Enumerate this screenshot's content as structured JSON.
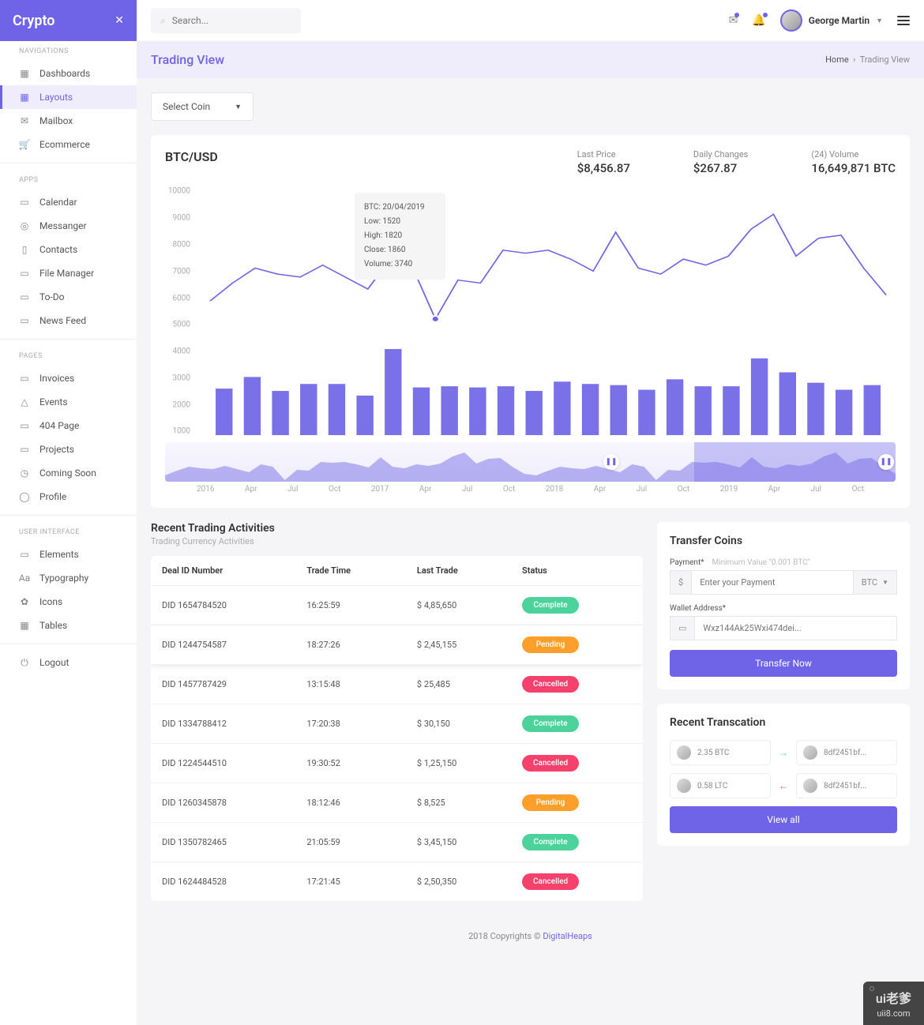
{
  "brand": "Crypto",
  "search_placeholder": "Search...",
  "user": {
    "name": "George Martin"
  },
  "nav": {
    "sections": [
      {
        "header": "NAVIGATIONS",
        "items": [
          {
            "label": "Dashboards",
            "icon": "▦"
          },
          {
            "label": "Layouts",
            "icon": "▦",
            "active": true
          },
          {
            "label": "Mailbox",
            "icon": "✉"
          },
          {
            "label": "Ecommerce",
            "icon": "🛒"
          }
        ]
      },
      {
        "header": "APPS",
        "items": [
          {
            "label": "Calendar",
            "icon": "▭"
          },
          {
            "label": "Messanger",
            "icon": "◎"
          },
          {
            "label": "Contacts",
            "icon": "▯"
          },
          {
            "label": "File Manager",
            "icon": "▭"
          },
          {
            "label": "To-Do",
            "icon": "▭"
          },
          {
            "label": "News Feed",
            "icon": "▭"
          }
        ]
      },
      {
        "header": "PAGES",
        "items": [
          {
            "label": "Invoices",
            "icon": "▭"
          },
          {
            "label": "Events",
            "icon": "△"
          },
          {
            "label": "404 Page",
            "icon": "▭"
          },
          {
            "label": "Projects",
            "icon": "▭"
          },
          {
            "label": "Coming Soon",
            "icon": "◷"
          },
          {
            "label": "Profile",
            "icon": "◯"
          }
        ]
      },
      {
        "header": "USER INTERFACE",
        "items": [
          {
            "label": "Elements",
            "icon": "▭"
          },
          {
            "label": "Typography",
            "icon": "Aa"
          },
          {
            "label": "Icons",
            "icon": "✿"
          },
          {
            "label": "Tables",
            "icon": "▦"
          }
        ]
      }
    ],
    "logout": "Logout"
  },
  "page": {
    "title": "Trading View",
    "breadcrumb_home": "Home",
    "breadcrumb_current": "Trading View"
  },
  "select_coin": "Select Coin",
  "chart": {
    "pair": "BTC/USD",
    "stats": {
      "last_price_label": "Last Price",
      "last_price": "$8,456.87",
      "daily_changes_label": "Daily Changes",
      "daily_changes": "$267.87",
      "volume_label": "(24) Volume",
      "volume": "16,649,871 BTC"
    },
    "tooltip": {
      "date": "BTC: 20/04/2019",
      "low": "Low: 1520",
      "high": "High: 1820",
      "close": "Close: 1860",
      "volume": "Volume: 3740"
    }
  },
  "chart_data": {
    "type": "combo",
    "y_ticks": [
      1000,
      2000,
      3000,
      4000,
      5000,
      6000,
      7000,
      8000,
      9000,
      10000
    ],
    "line_series": {
      "name": "Price",
      "ylim": [
        5500,
        10000
      ],
      "values": [
        6300,
        6900,
        7400,
        7200,
        7100,
        7500,
        7100,
        6700,
        7700,
        7400,
        5700,
        7000,
        6900,
        8000,
        7900,
        8000,
        7700,
        7300,
        8600,
        7400,
        7200,
        7700,
        7500,
        7800,
        8700,
        9200,
        7800,
        8400,
        8500,
        7400,
        6500
      ]
    },
    "bar_series": {
      "name": "Volume",
      "ylim": [
        0,
        4000
      ],
      "values": [
        2000,
        2500,
        1900,
        2200,
        2200,
        1700,
        3700,
        2050,
        2100,
        2050,
        2100,
        1900,
        2300,
        2200,
        2150,
        1950,
        2400,
        2100,
        2100,
        3300,
        2700,
        2250,
        1950,
        2150
      ]
    },
    "brush_x_ticks": [
      "2016",
      "Apr",
      "Jul",
      "Oct",
      "2017",
      "Apr",
      "Jul",
      "Oct",
      "2018",
      "Apr",
      "Jul",
      "Oct",
      "2019",
      "Apr",
      "Jul",
      "Oct"
    ]
  },
  "activities": {
    "title": "Recent Trading Activities",
    "subtitle": "Trading Currency Activities",
    "headers": {
      "deal": "Deal ID Number",
      "time": "Trade Time",
      "last": "Last Trade",
      "status": "Status"
    },
    "rows": [
      {
        "deal": "DID 1654784520",
        "time": "16:25:59",
        "last": "$ 4,85,650",
        "status": "Complete",
        "status_class": "complete"
      },
      {
        "deal": "DID 1244754587",
        "time": "18:27:26",
        "last": "$ 2,45,155",
        "status": "Pending",
        "status_class": "pending",
        "highlight": true
      },
      {
        "deal": "DID 1457787429",
        "time": "13:15:48",
        "last": "$ 25,485",
        "status": "Cancelled",
        "status_class": "cancelled"
      },
      {
        "deal": "DID 1334788412",
        "time": "17:20:38",
        "last": "$ 30,150",
        "status": "Complete",
        "status_class": "complete"
      },
      {
        "deal": "DID 1224544510",
        "time": "19:30:52",
        "last": "$ 1,25,150",
        "status": "Cancelled",
        "status_class": "cancelled"
      },
      {
        "deal": "DID 1260345878",
        "time": "18:12:46",
        "last": "$ 8,525",
        "status": "Pending",
        "status_class": "pending"
      },
      {
        "deal": "DID 1350782465",
        "time": "21:05:59",
        "last": "$ 3,45,150",
        "status": "Complete",
        "status_class": "complete"
      },
      {
        "deal": "DID 1624484528",
        "time": "17:21:45",
        "last": "$ 2,50,350",
        "status": "Cancelled",
        "status_class": "cancelled"
      }
    ]
  },
  "transfer": {
    "title": "Transfer Coins",
    "payment_label": "Payment*",
    "payment_hint": "Minimum Value \"0.001 BTC\"",
    "payment_placeholder": "Enter your Payment",
    "currency": "BTC",
    "wallet_label": "Wallet Address*",
    "wallet_placeholder": "Wxz144Ak25Wxi474dei...",
    "button": "Transfer Now"
  },
  "recent_tx": {
    "title": "Recent Transcation",
    "rows": [
      {
        "amount": "2.35 BTC",
        "dir": "green",
        "addr": "8df2451bf..."
      },
      {
        "amount": "0.58 LTC",
        "dir": "red",
        "addr": "8df2451bf..."
      }
    ],
    "button": "View all"
  },
  "footer": {
    "text": "2018 Copyrights © ",
    "link": "DigitalHeaps"
  },
  "watermark": {
    "top": "ui老爹",
    "bottom": "uii8.com"
  }
}
